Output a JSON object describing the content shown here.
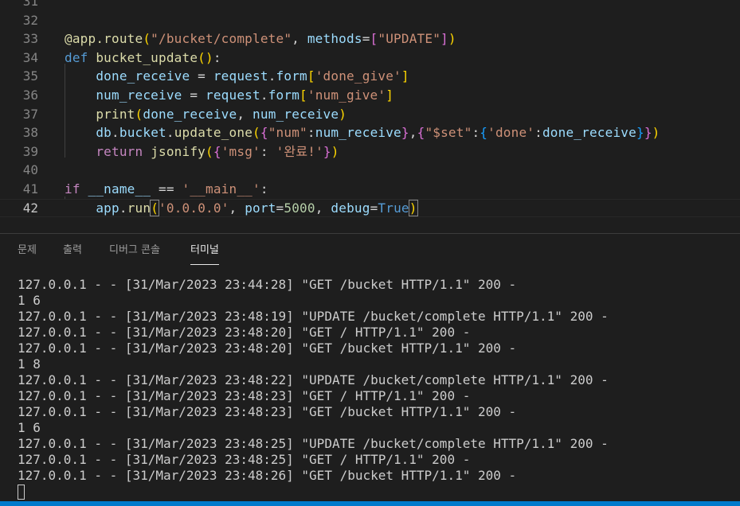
{
  "editor": {
    "lines": [
      {
        "num": "31",
        "tokens": []
      },
      {
        "num": "32",
        "tokens": []
      },
      {
        "num": "33",
        "tokens": [
          {
            "t": "@app.route",
            "c": "t-dec"
          },
          {
            "t": "(",
            "c": "t-b1"
          },
          {
            "t": "\"/bucket/complete\"",
            "c": "t-str"
          },
          {
            "t": ", ",
            "c": "t-plain"
          },
          {
            "t": "methods",
            "c": "t-var"
          },
          {
            "t": "=",
            "c": "t-plain"
          },
          {
            "t": "[",
            "c": "t-b2"
          },
          {
            "t": "\"UPDATE\"",
            "c": "t-str"
          },
          {
            "t": "]",
            "c": "t-b2"
          },
          {
            "t": ")",
            "c": "t-b1"
          }
        ]
      },
      {
        "num": "34",
        "tokens": [
          {
            "t": "def ",
            "c": "t-kw"
          },
          {
            "t": "bucket_update",
            "c": "t-fn"
          },
          {
            "t": "()",
            "c": "t-b1"
          },
          {
            "t": ":",
            "c": "t-plain"
          }
        ]
      },
      {
        "num": "35",
        "tokens": [
          {
            "t": "    ",
            "c": "t-plain"
          },
          {
            "t": "done_receive",
            "c": "t-var"
          },
          {
            "t": " = ",
            "c": "t-plain"
          },
          {
            "t": "request",
            "c": "t-var"
          },
          {
            "t": ".",
            "c": "t-plain"
          },
          {
            "t": "form",
            "c": "t-var"
          },
          {
            "t": "[",
            "c": "t-b1"
          },
          {
            "t": "'done_give'",
            "c": "t-str"
          },
          {
            "t": "]",
            "c": "t-b1"
          }
        ]
      },
      {
        "num": "36",
        "tokens": [
          {
            "t": "    ",
            "c": "t-plain"
          },
          {
            "t": "num_receive",
            "c": "t-var"
          },
          {
            "t": " = ",
            "c": "t-plain"
          },
          {
            "t": "request",
            "c": "t-var"
          },
          {
            "t": ".",
            "c": "t-plain"
          },
          {
            "t": "form",
            "c": "t-var"
          },
          {
            "t": "[",
            "c": "t-b1"
          },
          {
            "t": "'num_give'",
            "c": "t-str"
          },
          {
            "t": "]",
            "c": "t-b1"
          }
        ]
      },
      {
        "num": "37",
        "tokens": [
          {
            "t": "    ",
            "c": "t-plain"
          },
          {
            "t": "print",
            "c": "t-fn"
          },
          {
            "t": "(",
            "c": "t-b1"
          },
          {
            "t": "done_receive",
            "c": "t-var"
          },
          {
            "t": ", ",
            "c": "t-plain"
          },
          {
            "t": "num_receive",
            "c": "t-var"
          },
          {
            "t": ")",
            "c": "t-b1"
          }
        ]
      },
      {
        "num": "38",
        "tokens": [
          {
            "t": "    ",
            "c": "t-plain"
          },
          {
            "t": "db",
            "c": "t-var"
          },
          {
            "t": ".",
            "c": "t-plain"
          },
          {
            "t": "bucket",
            "c": "t-var"
          },
          {
            "t": ".",
            "c": "t-plain"
          },
          {
            "t": "update_one",
            "c": "t-fn"
          },
          {
            "t": "(",
            "c": "t-b1"
          },
          {
            "t": "{",
            "c": "t-b2"
          },
          {
            "t": "\"num\"",
            "c": "t-str"
          },
          {
            "t": ":",
            "c": "t-plain"
          },
          {
            "t": "num_receive",
            "c": "t-var"
          },
          {
            "t": "}",
            "c": "t-b2"
          },
          {
            "t": ",",
            "c": "t-plain"
          },
          {
            "t": "{",
            "c": "t-b2"
          },
          {
            "t": "\"$set\"",
            "c": "t-str"
          },
          {
            "t": ":",
            "c": "t-plain"
          },
          {
            "t": "{",
            "c": "t-b3"
          },
          {
            "t": "'done'",
            "c": "t-str"
          },
          {
            "t": ":",
            "c": "t-plain"
          },
          {
            "t": "done_receive",
            "c": "t-var"
          },
          {
            "t": "}",
            "c": "t-b3"
          },
          {
            "t": "}",
            "c": "t-b2"
          },
          {
            "t": ")",
            "c": "t-b1"
          }
        ]
      },
      {
        "num": "39",
        "tokens": [
          {
            "t": "    ",
            "c": "t-plain"
          },
          {
            "t": "return ",
            "c": "t-ctl"
          },
          {
            "t": "jsonify",
            "c": "t-fn"
          },
          {
            "t": "(",
            "c": "t-b1"
          },
          {
            "t": "{",
            "c": "t-b2"
          },
          {
            "t": "'msg'",
            "c": "t-str"
          },
          {
            "t": ": ",
            "c": "t-plain"
          },
          {
            "t": "'완료!'",
            "c": "t-str"
          },
          {
            "t": "}",
            "c": "t-b2"
          },
          {
            "t": ")",
            "c": "t-b1"
          }
        ]
      },
      {
        "num": "40",
        "tokens": []
      },
      {
        "num": "41",
        "tokens": [
          {
            "t": "if ",
            "c": "t-ctl"
          },
          {
            "t": "__name__",
            "c": "t-var"
          },
          {
            "t": " == ",
            "c": "t-plain"
          },
          {
            "t": "'__main__'",
            "c": "t-str"
          },
          {
            "t": ":",
            "c": "t-plain"
          }
        ]
      },
      {
        "num": "42",
        "active": true,
        "tokens": [
          {
            "t": "    ",
            "c": "t-plain"
          },
          {
            "t": "app",
            "c": "t-var"
          },
          {
            "t": ".",
            "c": "t-plain"
          },
          {
            "t": "run",
            "c": "t-fn"
          },
          {
            "t": "(",
            "c": "t-b1 bracket-match"
          },
          {
            "t": "'0.0.0.0'",
            "c": "t-str"
          },
          {
            "t": ", ",
            "c": "t-plain"
          },
          {
            "t": "port",
            "c": "t-var"
          },
          {
            "t": "=",
            "c": "t-plain"
          },
          {
            "t": "5000",
            "c": "t-num"
          },
          {
            "t": ", ",
            "c": "t-plain"
          },
          {
            "t": "debug",
            "c": "t-var"
          },
          {
            "t": "=",
            "c": "t-plain"
          },
          {
            "t": "True",
            "c": "t-kw"
          },
          {
            "t": ")",
            "c": "t-b1 bracket-match"
          }
        ]
      }
    ]
  },
  "panel": {
    "tabs": [
      {
        "label": "문제",
        "name": "tab-problems"
      },
      {
        "label": "출력",
        "name": "tab-output"
      },
      {
        "label": "디버그 콘솔",
        "name": "tab-debug-console"
      },
      {
        "label": "터미널",
        "name": "tab-terminal",
        "active": true
      }
    ]
  },
  "terminal": {
    "lines": [
      "127.0.0.1 - - [31/Mar/2023 23:44:28] \"GET /bucket HTTP/1.1\" 200 -",
      "1 6",
      "127.0.0.1 - - [31/Mar/2023 23:48:19] \"UPDATE /bucket/complete HTTP/1.1\" 200 -",
      "127.0.0.1 - - [31/Mar/2023 23:48:20] \"GET / HTTP/1.1\" 200 -",
      "127.0.0.1 - - [31/Mar/2023 23:48:20] \"GET /bucket HTTP/1.1\" 200 -",
      "1 8",
      "127.0.0.1 - - [31/Mar/2023 23:48:22] \"UPDATE /bucket/complete HTTP/1.1\" 200 -",
      "127.0.0.1 - - [31/Mar/2023 23:48:23] \"GET / HTTP/1.1\" 200 -",
      "127.0.0.1 - - [31/Mar/2023 23:48:23] \"GET /bucket HTTP/1.1\" 200 -",
      "1 6",
      "127.0.0.1 - - [31/Mar/2023 23:48:25] \"UPDATE /bucket/complete HTTP/1.1\" 200 -",
      "127.0.0.1 - - [31/Mar/2023 23:48:25] \"GET / HTTP/1.1\" 200 -",
      "127.0.0.1 - - [31/Mar/2023 23:48:26] \"GET /bucket HTTP/1.1\" 200 -"
    ]
  },
  "colors": {
    "background": "#1e1e1e",
    "statusbar": "#007acc"
  }
}
